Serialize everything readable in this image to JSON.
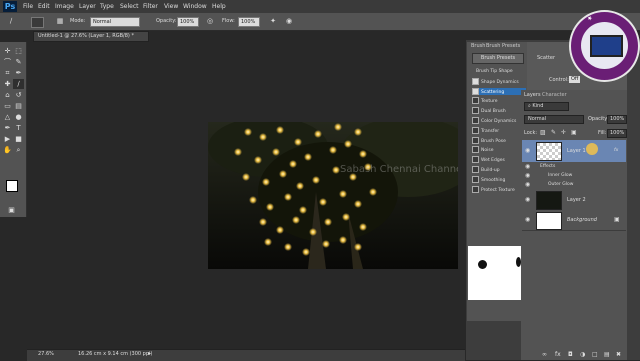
{
  "app": {
    "logo": "Ps"
  },
  "menu": [
    "File",
    "Edit",
    "Image",
    "Layer",
    "Type",
    "Select",
    "Filter",
    "View",
    "Window",
    "Help"
  ],
  "options": {
    "mode_label": "Mode:",
    "mode_value": "Normal",
    "opacity_label": "Opacity:",
    "opacity_value": "100%",
    "flow_label": "Flow:",
    "flow_value": "100%"
  },
  "document": {
    "tab_title": "Untitled-1 @ 27.6% (Layer 1, RGB/8) *",
    "zoom": "27.6%",
    "doc_size": "16.26 cm x 9.14 cm (300 ppi)"
  },
  "watermark_text": "Sabash Chennai Channel",
  "brush_panel": {
    "tabs": [
      "Brush",
      "Brush Presets"
    ],
    "presets_button": "Brush Presets",
    "scatter_label": "Scatter",
    "control_label": "Control:",
    "control_value": "Off",
    "options": [
      {
        "label": "Brush Tip Shape",
        "checkbox": false,
        "checked": false,
        "active": false
      },
      {
        "label": "Shape Dynamics",
        "checkbox": true,
        "checked": true,
        "active": false
      },
      {
        "label": "Scattering",
        "checkbox": true,
        "checked": true,
        "active": true
      },
      {
        "label": "Texture",
        "checkbox": true,
        "checked": false,
        "active": false
      },
      {
        "label": "Dual Brush",
        "checkbox": true,
        "checked": false,
        "active": false
      },
      {
        "label": "Color Dynamics",
        "checkbox": true,
        "checked": false,
        "active": false
      },
      {
        "label": "Transfer",
        "checkbox": true,
        "checked": false,
        "active": false
      },
      {
        "label": "Brush Pose",
        "checkbox": true,
        "checked": false,
        "active": false
      },
      {
        "label": "Noise",
        "checkbox": true,
        "checked": false,
        "active": false
      },
      {
        "label": "Wet Edges",
        "checkbox": true,
        "checked": false,
        "active": false
      },
      {
        "label": "Build-up",
        "checkbox": true,
        "checked": false,
        "active": false
      },
      {
        "label": "Smoothing",
        "checkbox": true,
        "checked": false,
        "active": false
      },
      {
        "label": "Protect Texture",
        "checkbox": true,
        "checked": false,
        "active": false
      }
    ]
  },
  "layers_panel": {
    "tabs": [
      "Layers",
      "Character"
    ],
    "kind_label": "Kind",
    "blend_mode": "Normal",
    "opacity_label": "Opacity:",
    "opacity_value": "100%",
    "lock_label": "Lock:",
    "fill_label": "Fill:",
    "fill_value": "100%",
    "layers": [
      {
        "name": "Layer 1",
        "selected": true,
        "fx": "fx"
      },
      {
        "name": "Layer 2",
        "selected": false,
        "fx": ""
      },
      {
        "name": "Background",
        "selected": false,
        "fx": ""
      }
    ],
    "effects_label": "Effects",
    "effects": [
      "Inner Glow",
      "Outer Glow"
    ]
  },
  "colors": {
    "accent": "#2c6fb5",
    "panel": "#535353",
    "bg": "#282828",
    "logo_purple": "#6a1e75"
  }
}
